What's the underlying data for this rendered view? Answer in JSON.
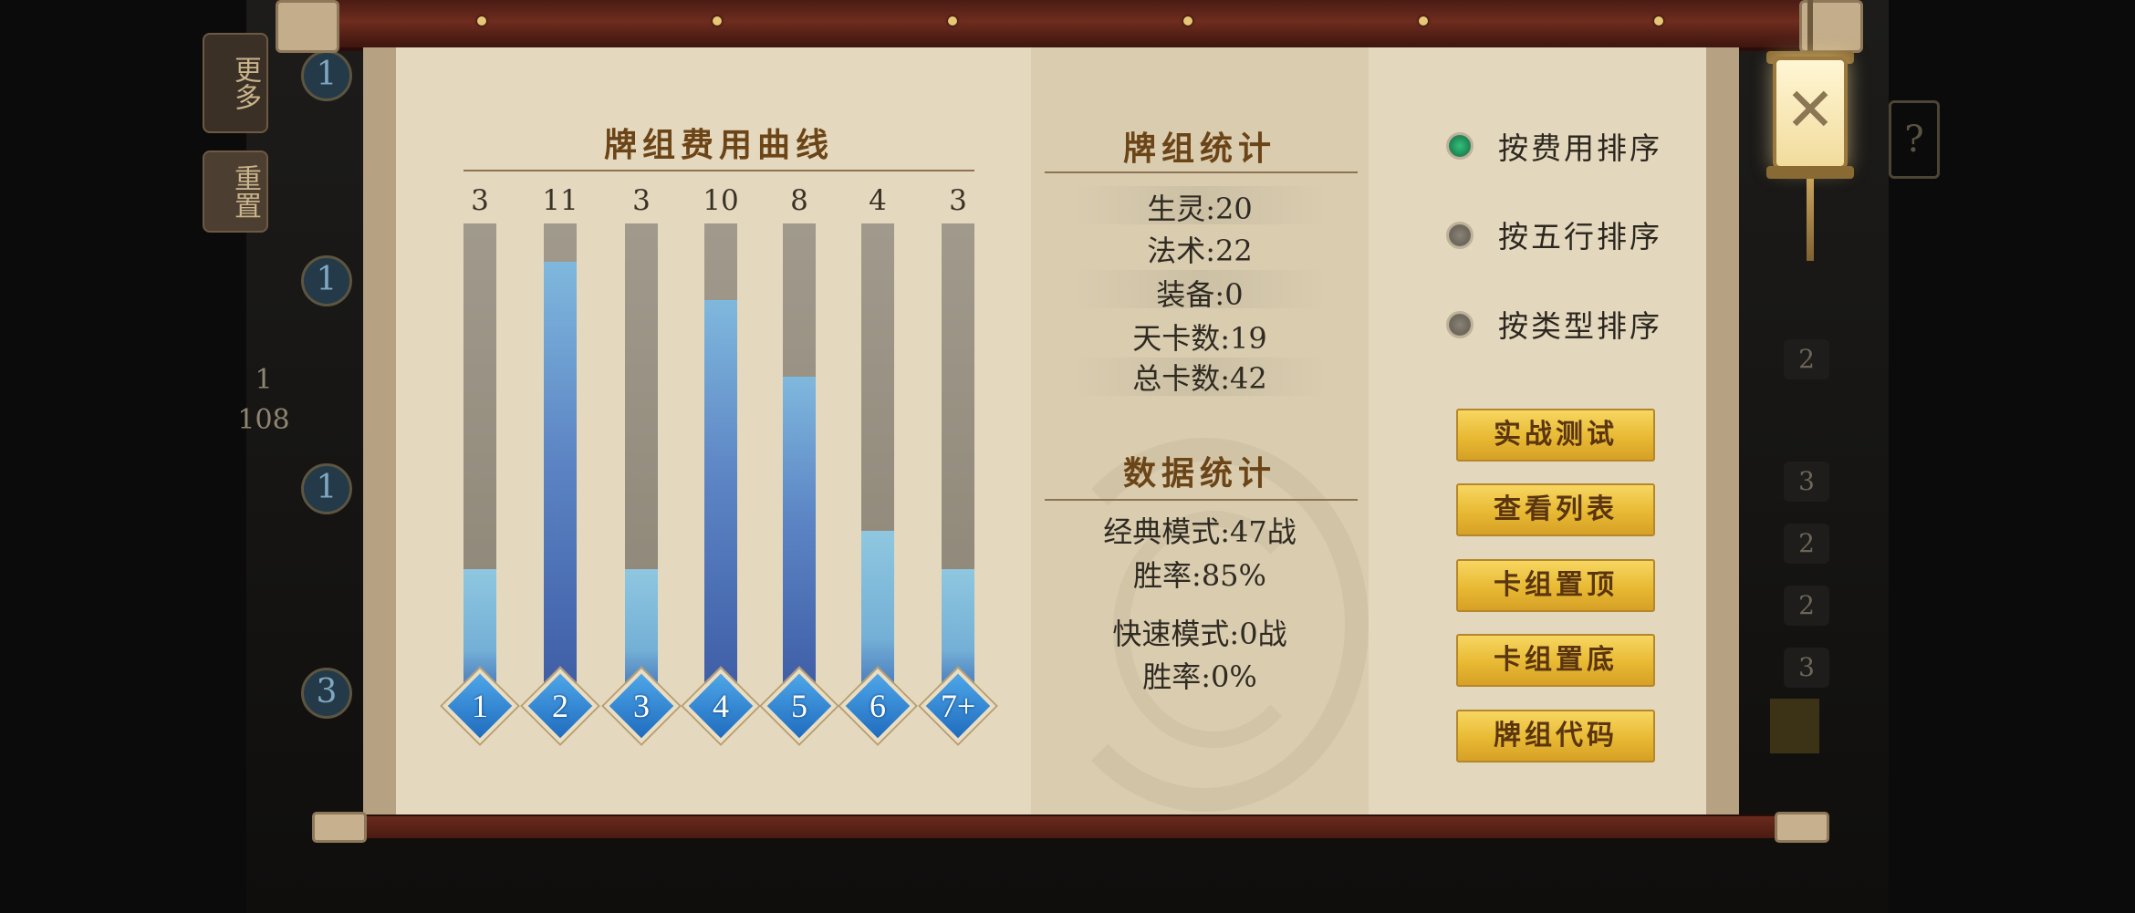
{
  "background": {
    "left_tabs": [
      "更多",
      "重置"
    ],
    "page_indicator": {
      "current": "1",
      "total": "108"
    },
    "side_badges": [
      "1",
      "1",
      "1",
      "3"
    ],
    "right_counts": [
      "2",
      "3",
      "2",
      "2",
      "3"
    ],
    "help_glyph": "?"
  },
  "cost_curve": {
    "title": "牌组费用曲线"
  },
  "chart_data": {
    "type": "bar",
    "title": "牌组费用曲线",
    "categories": [
      "1",
      "2",
      "3",
      "4",
      "5",
      "6",
      "7+"
    ],
    "values": [
      3,
      11,
      3,
      10,
      8,
      4,
      3
    ],
    "ylim": [
      0,
      12
    ]
  },
  "deck_stats": {
    "title": "牌组统计",
    "creatures": "生灵:20",
    "spells": "法术:22",
    "equipment": "装备:0",
    "sky_cards": "天卡数:19",
    "total": "总卡数:42"
  },
  "data_stats": {
    "title": "数据统计",
    "classic": "经典模式:47战",
    "classic_rate": "胜率:85%",
    "quick": "快速模式:0战",
    "quick_rate": "胜率:0%"
  },
  "sort": {
    "by_cost": "按费用排序",
    "by_element": "按五行排序",
    "by_type": "按类型排序",
    "selected": "by_cost"
  },
  "buttons": {
    "test": "实战测试",
    "list": "查看列表",
    "pin_top": "卡组置顶",
    "pin_bottom": "卡组置底",
    "code": "牌组代码"
  },
  "close": {
    "glyph": "✕"
  },
  "colors": {
    "accent_gold": "#e8b933",
    "bar_blue": "#5d86c5",
    "title_brown": "#6b4417",
    "radio_on": "#1f8a56"
  }
}
